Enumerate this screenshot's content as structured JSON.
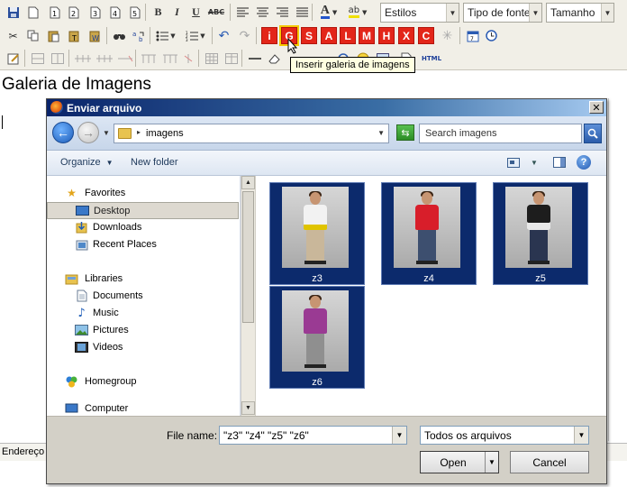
{
  "toolbar": {
    "row1_buttons": [
      "save-icon",
      "new-doc-icon",
      "numbered-1-icon",
      "numbered-2-icon",
      "numbered-3-icon",
      "numbered-4-icon",
      "numbered-5-icon"
    ],
    "bold": "B",
    "italic": "I",
    "underline": "U",
    "strike": "ABC",
    "styles": "Estilos",
    "font": "Tipo de fonte",
    "size": "Tamanho",
    "plugins": [
      "i",
      "G",
      "S",
      "A",
      "L",
      "M",
      "H",
      "X",
      "C"
    ],
    "html_button": "HTML"
  },
  "tooltip": "Inserir galeria de imagens",
  "document": {
    "title": "Galeria de Imagens"
  },
  "statusbar": {
    "label": "Endereço"
  },
  "dialog": {
    "title": "Enviar arquivo",
    "address": {
      "path": "imagens"
    },
    "search_placeholder": "Search imagens",
    "commands": {
      "organize": "Organize",
      "new_folder": "New folder"
    },
    "nav": {
      "favorites": "Favorites",
      "desktop": "Desktop",
      "downloads": "Downloads",
      "recent_places": "Recent Places",
      "libraries": "Libraries",
      "documents": "Documents",
      "music": "Music",
      "pictures": "Pictures",
      "videos": "Videos",
      "homegroup": "Homegroup",
      "computer": "Computer"
    },
    "files": [
      {
        "name": "z3",
        "shirt": "#f2f2f2",
        "accent": "#e0c400"
      },
      {
        "name": "z4",
        "shirt": "#d81e2a",
        "accent": "#ffffff"
      },
      {
        "name": "z5",
        "shirt": "#1d1d1d",
        "accent": "#ffffff"
      },
      {
        "name": "z6",
        "shirt": "#9a3a93",
        "accent": "#ffffff"
      }
    ],
    "filename_label": "File name:",
    "filename_value": "\"z3\" \"z4\" \"z5\" \"z6\"",
    "filetype": "Todos os arquivos",
    "open_label": "Open",
    "cancel_label": "Cancel"
  }
}
